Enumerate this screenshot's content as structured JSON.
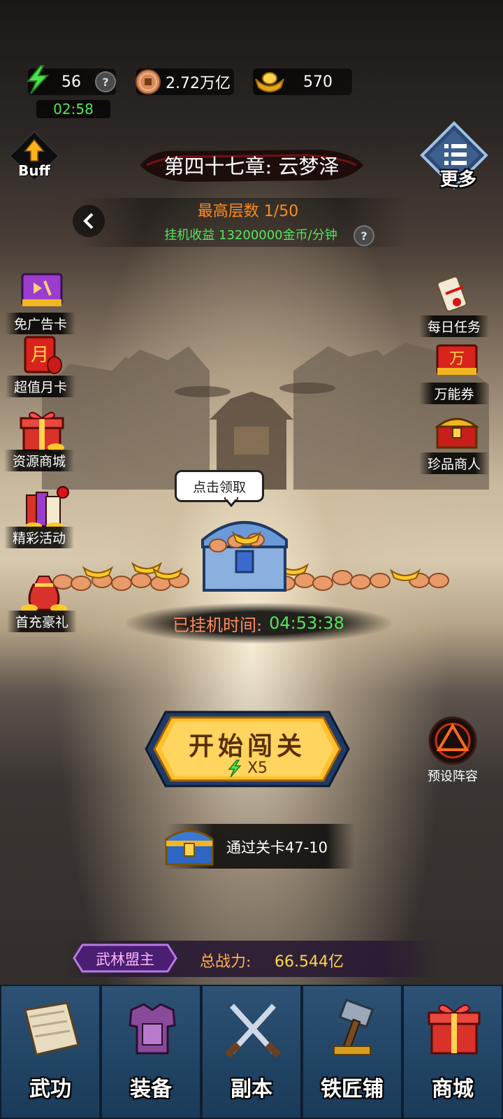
{
  "resources": {
    "energy": "56",
    "energy_timer": "02:58",
    "coins": "2.72万亿",
    "ingots": "570"
  },
  "buff_label": "Buff",
  "more_label": "更多",
  "chapter_title": "第四十七章: 云梦泽",
  "highest_floor_label": "最高层数",
  "highest_floor_value": "1/50",
  "idle_income_label": "挂机收益",
  "idle_income_value": "13200000金币/分钟",
  "left_buttons": [
    "免广告卡",
    "超值月卡",
    "资源商城",
    "精彩活动",
    "首充豪礼"
  ],
  "right_buttons": [
    "每日任务",
    "万能券",
    "珍品商人"
  ],
  "chest_tooltip": "点击领取",
  "idle_time_label": "已挂机时间:",
  "idle_time_value": "04:53:38",
  "start_button": {
    "label": "开始闯关",
    "cost": "X5"
  },
  "preset_label": "预设阵容",
  "stage_reward": "通过关卡47-10",
  "rank_badge": "武林盟主",
  "total_power_label": "总战力:",
  "total_power_value": "66.544亿",
  "nav": [
    "武功",
    "装备",
    "副本",
    "铁匠铺",
    "商城"
  ],
  "colors": {
    "accent_green": "#52e65c",
    "accent_orange": "#ff8a1e",
    "gold": "#f5c030"
  }
}
